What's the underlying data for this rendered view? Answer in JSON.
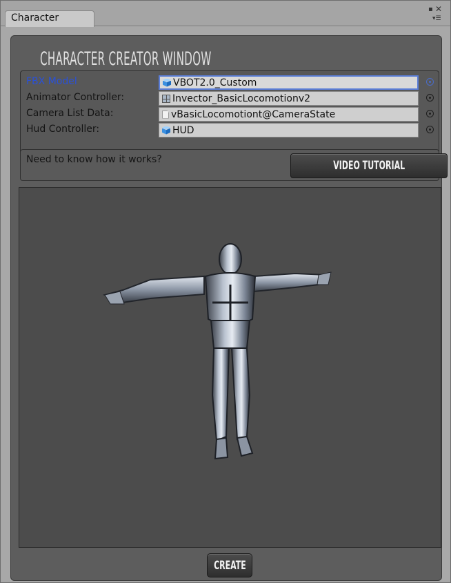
{
  "window": {
    "tab_label": "Character",
    "title": "CHARACTER CREATOR WINDOW"
  },
  "fields": [
    {
      "label": "FBX Model",
      "value": "VBOT2.0_Custom",
      "icon": "cube-icon",
      "active": true
    },
    {
      "label": "Animator Controller:",
      "value": "Invector_BasicLocomotionv2",
      "icon": "animator-icon",
      "active": false
    },
    {
      "label": "Camera List Data:",
      "value": "vBasicLocomotiont@CameraState",
      "icon": "document-icon",
      "active": false
    },
    {
      "label": "Hud Controller:",
      "value": "HUD",
      "icon": "cube-icon",
      "active": false
    }
  ],
  "help": {
    "question": "Need to know how it works?",
    "video_button": "VIDEO TUTORIAL"
  },
  "preview": {
    "content": "robot-character-t-pose"
  },
  "create_button": "CREATE",
  "colors": {
    "active_label": "#2a51d8",
    "panel_bg": "#5d5d5d",
    "viewport_bg": "#4c4c4c"
  }
}
